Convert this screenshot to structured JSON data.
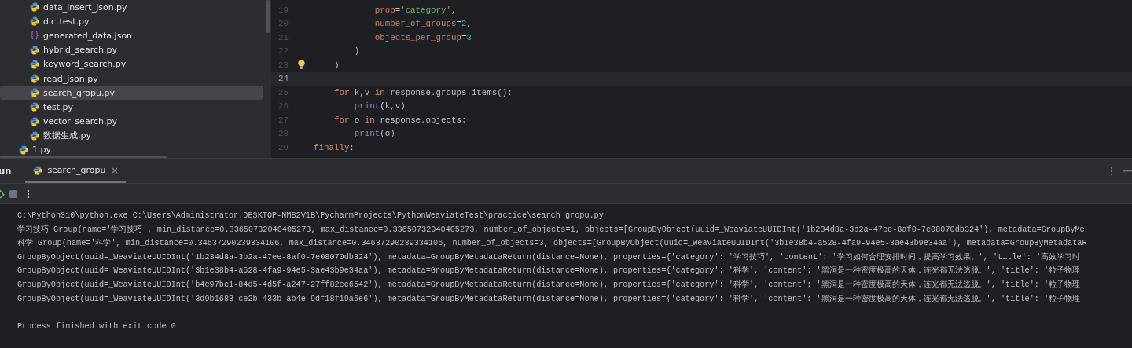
{
  "project_tree": {
    "folder_files": [
      {
        "name": "data_insert_json.py",
        "kind": "py",
        "selected": false
      },
      {
        "name": "dicttest.py",
        "kind": "py",
        "selected": false
      },
      {
        "name": "generated_data.json",
        "kind": "json",
        "selected": false
      },
      {
        "name": "hybrid_search.py",
        "kind": "py",
        "selected": false
      },
      {
        "name": "keyword_search.py",
        "kind": "py",
        "selected": false
      },
      {
        "name": "read_json.py",
        "kind": "py",
        "selected": false
      },
      {
        "name": "search_gropu.py",
        "kind": "py",
        "selected": true
      },
      {
        "name": "test.py",
        "kind": "py",
        "selected": false
      },
      {
        "name": "vector_search.py",
        "kind": "py",
        "selected": false
      },
      {
        "name": "数据生成.py",
        "kind": "py",
        "selected": false
      }
    ],
    "root_files": [
      {
        "name": "1.py",
        "kind": "py",
        "selected": false
      }
    ]
  },
  "editor": {
    "lines": [
      {
        "number": "19",
        "current": false,
        "bulb": false,
        "tokens": [
          {
            "kind": "param",
            "text": "            prop"
          },
          {
            "kind": "plain",
            "text": "="
          },
          {
            "kind": "string",
            "text": "'category'"
          },
          {
            "kind": "plain",
            "text": ","
          }
        ]
      },
      {
        "number": "20",
        "current": false,
        "bulb": false,
        "tokens": [
          {
            "kind": "param",
            "text": "            number_of_groups"
          },
          {
            "kind": "plain",
            "text": "="
          },
          {
            "kind": "number",
            "text": "2"
          },
          {
            "kind": "plain",
            "text": ","
          }
        ]
      },
      {
        "number": "21",
        "current": false,
        "bulb": false,
        "tokens": [
          {
            "kind": "param",
            "text": "            objects_per_group"
          },
          {
            "kind": "plain",
            "text": "="
          },
          {
            "kind": "number",
            "text": "3"
          }
        ]
      },
      {
        "number": "22",
        "current": false,
        "bulb": false,
        "tokens": [
          {
            "kind": "plain",
            "text": "        )"
          }
        ]
      },
      {
        "number": "23",
        "current": false,
        "bulb": true,
        "tokens": [
          {
            "kind": "plain",
            "text": "    )"
          }
        ]
      },
      {
        "number": "24",
        "current": true,
        "bulb": false
      },
      {
        "number": "25",
        "current": false,
        "bulb": false,
        "tokens": [
          {
            "kind": "keyword",
            "text": "    for"
          },
          {
            "kind": "plain",
            "text": " k,v "
          },
          {
            "kind": "keyword",
            "text": "in"
          },
          {
            "kind": "plain",
            "text": " response.groups.items():"
          }
        ]
      },
      {
        "number": "26",
        "current": false,
        "bulb": false,
        "tokens": [
          {
            "kind": "builtin",
            "text": "        print"
          },
          {
            "kind": "plain",
            "text": "(k,v)"
          }
        ]
      },
      {
        "number": "27",
        "current": false,
        "bulb": false,
        "tokens": [
          {
            "kind": "keyword",
            "text": "    for"
          },
          {
            "kind": "plain",
            "text": " o "
          },
          {
            "kind": "keyword",
            "text": "in"
          },
          {
            "kind": "plain",
            "text": " response.objects:"
          }
        ]
      },
      {
        "number": "28",
        "current": false,
        "bulb": false,
        "tokens": [
          {
            "kind": "builtin",
            "text": "        print"
          },
          {
            "kind": "plain",
            "text": "(o)"
          }
        ]
      },
      {
        "number": "29",
        "current": false,
        "bulb": false,
        "tokens": [
          {
            "kind": "keyword",
            "text": "finally"
          },
          {
            "kind": "plain",
            "text": ":"
          }
        ]
      }
    ]
  },
  "run_panel": {
    "title": "un",
    "tabs": [
      {
        "label": "search_gropu",
        "selected": true
      }
    ],
    "console": {
      "output": [
        "C:\\Python310\\python.exe C:\\Users\\Administrator.DESKTOP-NM82V1B\\PycharmProjects\\PythonWeaviateTest\\practice\\search_gropu.py",
        "学习技巧 Group(name='学习技巧', min_distance=0.33650732040405273, max_distance=0.33650732040405273, number_of_objects=1, objects=[GroupByObject(uuid=_WeaviateUUIDInt('1b234d8a-3b2a-47ee-8af0-7e08070db324'), metadata=GroupByMe",
        "科学 Group(name='科学', min_distance=0.34637290239334106, max_distance=0.34637290239334106, number_of_objects=3, objects=[GroupByObject(uuid=_WeaviateUUIDInt('3b1e38b4-a528-4fa9-94e5-3ae43b9e34aa'), metadata=GroupByMetadataR",
        "GroupByObject(uuid=_WeaviateUUIDInt('1b234d8a-3b2a-47ee-8af0-7e08070db324'), metadata=GroupByMetadataReturn(distance=None), properties={'category': '学习技巧', 'content': '学习如何合理安排时间，提高学习效果。', 'title': '高效学习时",
        "GroupByObject(uuid=_WeaviateUUIDInt('3b1e38b4-a528-4fa9-94e5-3ae43b9e34aa'), metadata=GroupByMetadataReturn(distance=None), properties={'category': '科学', 'content': '黑洞是一种密度极高的天体，连光都无法逃脱。', 'title': '粒子物理",
        "GroupByObject(uuid=_WeaviateUUIDInt('b4e97be1-84d5-4d5f-a247-27ff82ec6542'), metadata=GroupByMetadataReturn(distance=None), properties={'category': '科学', 'content': '黑洞是一种密度极高的天体，连光都无法逃脱。', 'title': '粒子物理",
        "GroupByObject(uuid=_WeaviateUUIDInt('3d9b1683-ce2b-433b-ab4e-9df18f19a6e6'), metadata=GroupByMetadataReturn(distance=None), properties={'category': '科学', 'content': '黑洞是一种密度极高的天体，连光都无法逃脱。', 'title': '粒子物理"
      ],
      "exit_message": "Process finished with exit code 0"
    }
  }
}
